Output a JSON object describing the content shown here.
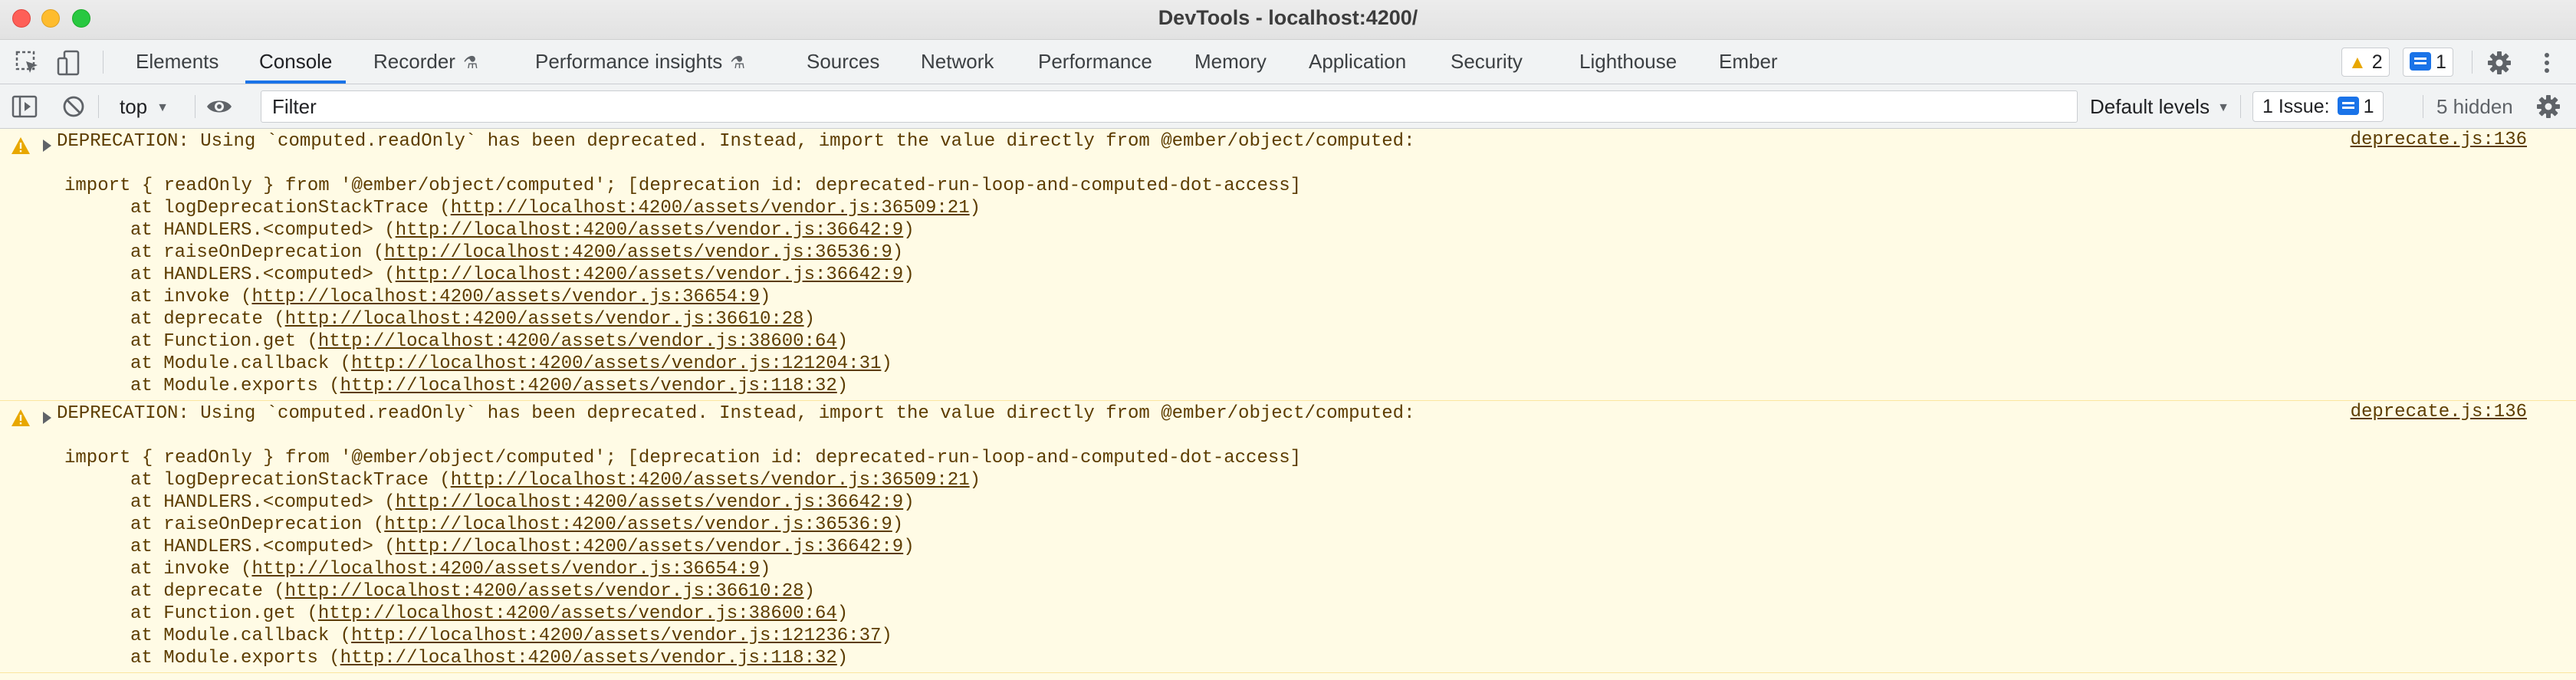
{
  "window": {
    "title": "DevTools - localhost:4200/"
  },
  "tabs": [
    {
      "label": "Elements",
      "experimental": false
    },
    {
      "label": "Console",
      "experimental": false,
      "active": true
    },
    {
      "label": "Recorder",
      "experimental": true
    },
    {
      "label": "Performance insights",
      "experimental": true
    },
    {
      "label": "Sources",
      "experimental": false
    },
    {
      "label": "Network",
      "experimental": false
    },
    {
      "label": "Performance",
      "experimental": false
    },
    {
      "label": "Memory",
      "experimental": false
    },
    {
      "label": "Application",
      "experimental": false
    },
    {
      "label": "Security",
      "experimental": false
    },
    {
      "label": "Lighthouse",
      "experimental": false
    },
    {
      "label": "Ember",
      "experimental": false
    }
  ],
  "badges": {
    "warnings": "2",
    "messages": "1"
  },
  "toolbar": {
    "context": "top",
    "filter_placeholder": "Filter",
    "levels": "Default levels",
    "issues_label": "1 Issue:",
    "issues_count": "1",
    "hidden": "5 hidden"
  },
  "colors": {
    "accent": "#1a73e8",
    "warning_bg": "#fffbe5",
    "warning_text": "#5c3c00",
    "warning_icon": "#e8a700"
  },
  "messages": [
    {
      "text": "DEPRECATION: Using `computed.readOnly` has been deprecated. Instead, import the value directly from @ember/object/computed:",
      "source": "deprecate.js:136",
      "detail": "import { readOnly } from '@ember/object/computed'; [deprecation id: deprecated-run-loop-and-computed-dot-access]",
      "stack": [
        {
          "fn": "logDeprecationStackTrace",
          "url": "http://localhost:4200/assets/vendor.js:36509:21"
        },
        {
          "fn": "HANDLERS.<computed>",
          "url": "http://localhost:4200/assets/vendor.js:36642:9"
        },
        {
          "fn": "raiseOnDeprecation",
          "url": "http://localhost:4200/assets/vendor.js:36536:9"
        },
        {
          "fn": "HANDLERS.<computed>",
          "url": "http://localhost:4200/assets/vendor.js:36642:9"
        },
        {
          "fn": "invoke",
          "url": "http://localhost:4200/assets/vendor.js:36654:9"
        },
        {
          "fn": "deprecate",
          "url": "http://localhost:4200/assets/vendor.js:36610:28"
        },
        {
          "fn": "Function.get",
          "url": "http://localhost:4200/assets/vendor.js:38600:64"
        },
        {
          "fn": "Module.callback",
          "url": "http://localhost:4200/assets/vendor.js:121204:31"
        },
        {
          "fn": "Module.exports",
          "url": "http://localhost:4200/assets/vendor.js:118:32"
        }
      ]
    },
    {
      "text": "DEPRECATION: Using `computed.readOnly` has been deprecated. Instead, import the value directly from @ember/object/computed:",
      "source": "deprecate.js:136",
      "detail": "import { readOnly } from '@ember/object/computed'; [deprecation id: deprecated-run-loop-and-computed-dot-access]",
      "stack": [
        {
          "fn": "logDeprecationStackTrace",
          "url": "http://localhost:4200/assets/vendor.js:36509:21"
        },
        {
          "fn": "HANDLERS.<computed>",
          "url": "http://localhost:4200/assets/vendor.js:36642:9"
        },
        {
          "fn": "raiseOnDeprecation",
          "url": "http://localhost:4200/assets/vendor.js:36536:9"
        },
        {
          "fn": "HANDLERS.<computed>",
          "url": "http://localhost:4200/assets/vendor.js:36642:9"
        },
        {
          "fn": "invoke",
          "url": "http://localhost:4200/assets/vendor.js:36654:9"
        },
        {
          "fn": "deprecate",
          "url": "http://localhost:4200/assets/vendor.js:36610:28"
        },
        {
          "fn": "Function.get",
          "url": "http://localhost:4200/assets/vendor.js:38600:64"
        },
        {
          "fn": "Module.callback",
          "url": "http://localhost:4200/assets/vendor.js:121236:37"
        },
        {
          "fn": "Module.exports",
          "url": "http://localhost:4200/assets/vendor.js:118:32"
        }
      ]
    }
  ]
}
